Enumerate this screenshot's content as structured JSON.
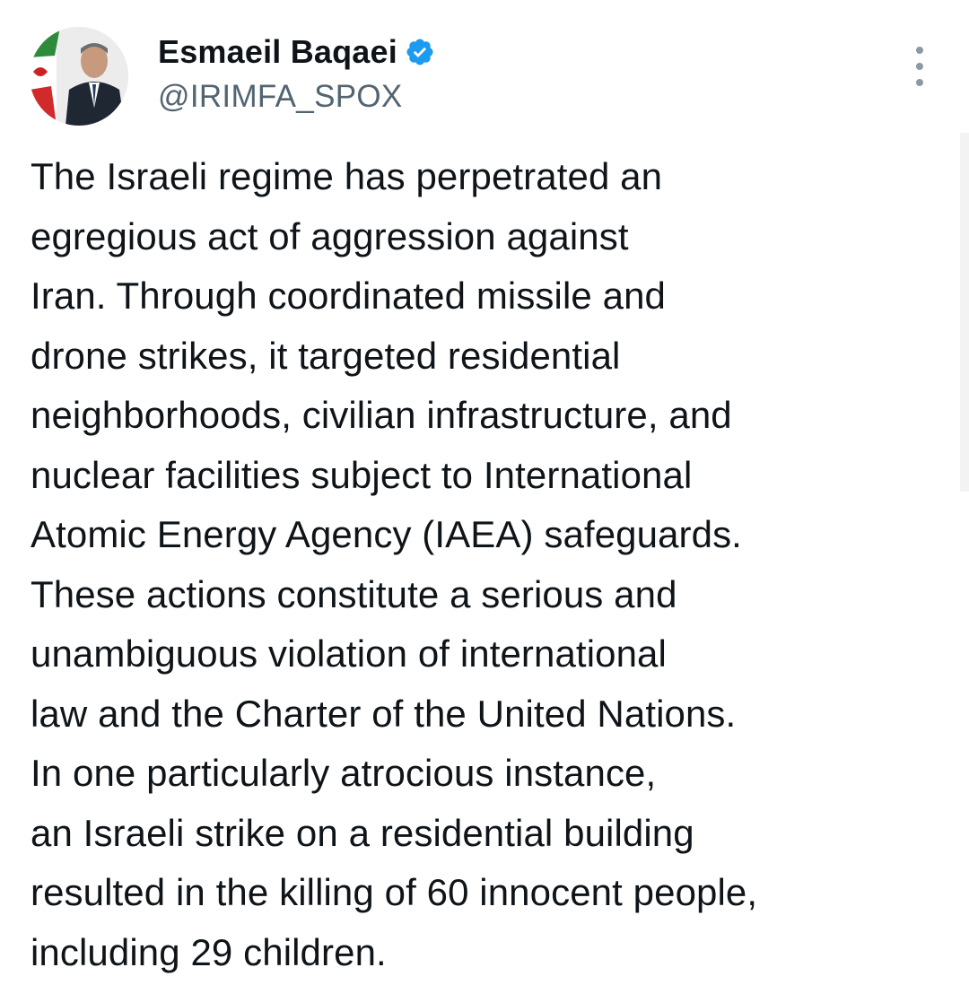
{
  "author": {
    "display_name": "Esmaeil Baqaei",
    "handle": "@IRIMFA_SPOX",
    "verified": true,
    "verified_color": "#1d9bf0"
  },
  "menu": {
    "icon": "more-vertical-icon"
  },
  "tweet": {
    "lines": [
      "The Israeli regime has perpetrated an",
      "egregious act of aggression against",
      "Iran. Through coordinated missile and",
      "drone strikes, it targeted residential",
      "neighborhoods, civilian infrastructure, and",
      "nuclear facilities subject to International",
      "Atomic Energy Agency (IAEA) safeguards.",
      "These actions constitute a serious and",
      "unambiguous violation of international",
      "law and the Charter of the United Nations.",
      "In one particularly atrocious instance,",
      "an Israeli strike on a residential building",
      "resulted in the killing of 60 innocent people,",
      "including 29 children."
    ]
  },
  "colors": {
    "text": "#0f1419",
    "secondary_text": "#536471",
    "background": "#ffffff"
  }
}
